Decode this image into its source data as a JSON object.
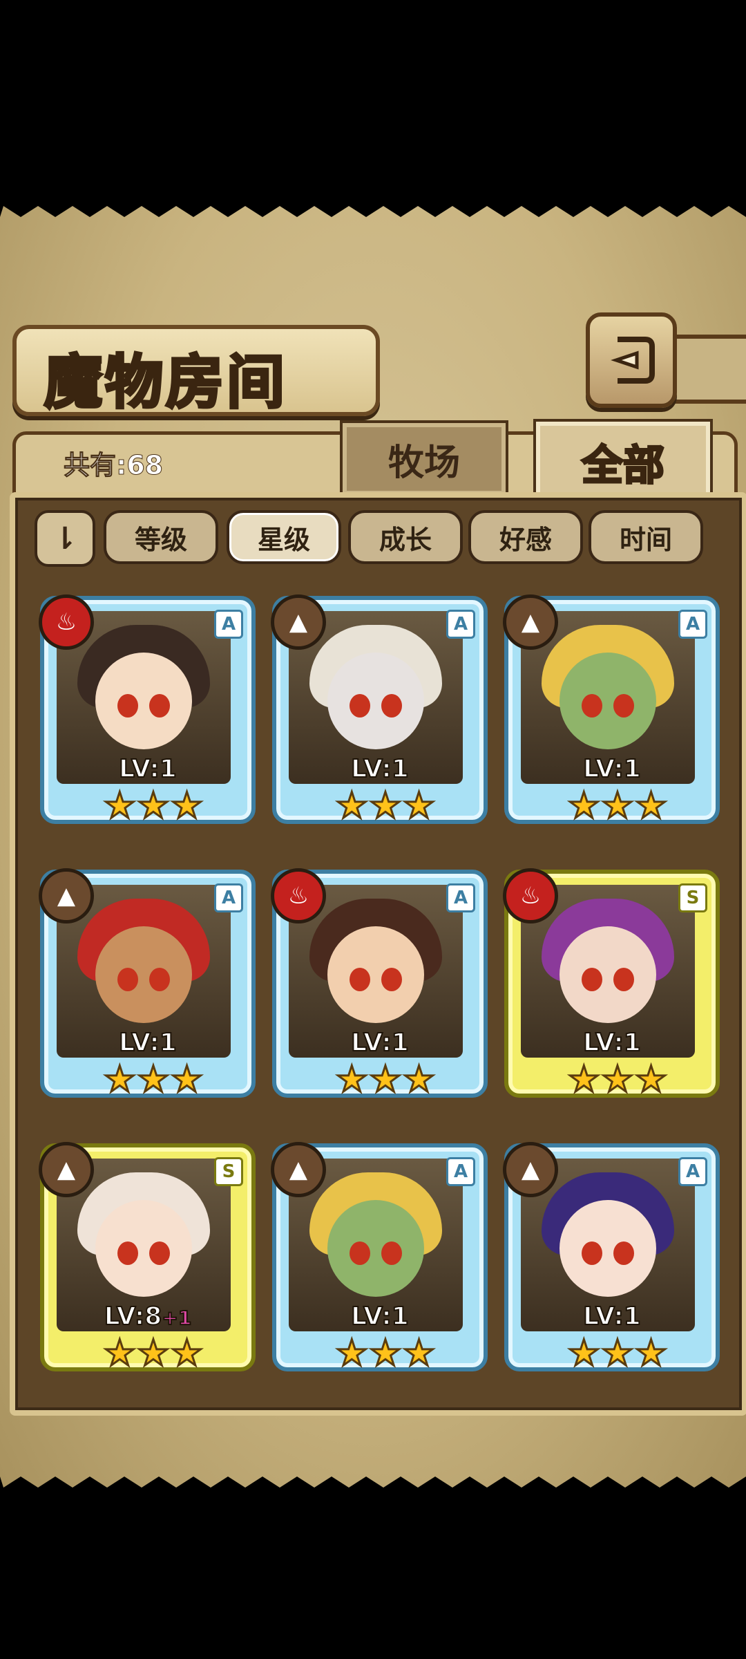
{
  "header": {
    "title": "魔物房间",
    "back_label": "back"
  },
  "summary": {
    "count_text": "共有:68"
  },
  "tabs": [
    {
      "label": "牧场",
      "active": false
    },
    {
      "label": "全部",
      "active": true
    }
  ],
  "sort": {
    "toggle_icon": "sort-toggle-icon",
    "buttons": [
      {
        "label": "等级",
        "active": false
      },
      {
        "label": "星级",
        "active": true
      },
      {
        "label": "成长",
        "active": false
      },
      {
        "label": "好感",
        "active": false
      },
      {
        "label": "时间",
        "active": false
      }
    ]
  },
  "monsters": [
    {
      "rank": "A",
      "element": "fire",
      "level": "LV:1",
      "bonus": "",
      "stars": 3,
      "hair": "#3a2a22",
      "skin": "#f5dcc4"
    },
    {
      "rank": "A",
      "element": "earth",
      "level": "LV:1",
      "bonus": "",
      "stars": 3,
      "hair": "#e8e2d6",
      "skin": "#e7e2e0"
    },
    {
      "rank": "A",
      "element": "earth",
      "level": "LV:1",
      "bonus": "",
      "stars": 3,
      "hair": "#e8c24a",
      "skin": "#8fb46a"
    },
    {
      "rank": "A",
      "element": "earth",
      "level": "LV:1",
      "bonus": "",
      "stars": 3,
      "hair": "#c12a24",
      "skin": "#c9905e"
    },
    {
      "rank": "A",
      "element": "fire",
      "level": "LV:1",
      "bonus": "",
      "stars": 3,
      "hair": "#4a2a1e",
      "skin": "#f2cfae"
    },
    {
      "rank": "S",
      "element": "fire",
      "level": "LV:1",
      "bonus": "",
      "stars": 3,
      "hair": "#8b3a9a",
      "skin": "#f2d8c8"
    },
    {
      "rank": "S",
      "element": "earth",
      "level": "LV:8",
      "bonus": "+1",
      "stars": 3,
      "hair": "#efe3d8",
      "skin": "#f7e0cf"
    },
    {
      "rank": "A",
      "element": "earth",
      "level": "LV:1",
      "bonus": "",
      "stars": 3,
      "hair": "#e8c24a",
      "skin": "#8fb46a"
    },
    {
      "rank": "A",
      "element": "earth",
      "level": "LV:1",
      "bonus": "",
      "stars": 3,
      "hair": "#3a2a7a",
      "skin": "#f7e0d2"
    }
  ],
  "colors": {
    "rank_A_frame": "#3d7fa3",
    "rank_S_frame": "#7a7a10",
    "fire": "#c4211e",
    "earth": "#6b4a2e",
    "star": "#ffc21a"
  }
}
